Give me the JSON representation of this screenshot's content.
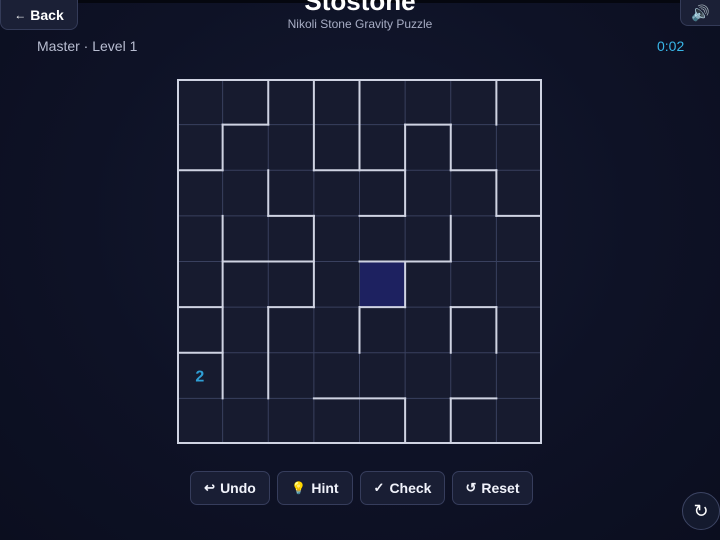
{
  "header": {
    "back_label": "Back",
    "back_icon": "←",
    "title": "Stostone",
    "subtitle": "Nikoli Stone Gravity Puzzle",
    "sound_icon": "🔊"
  },
  "status": {
    "level": "Master · Level 1",
    "timer": "0:02"
  },
  "board": {
    "size": 8,
    "clues": [
      {
        "row": 6,
        "col": 0,
        "value": "2"
      }
    ],
    "highlighted_cells": [
      {
        "row": 4,
        "col": 4
      }
    ],
    "colors": {
      "grid_line": "#39405e",
      "region_border": "#cfd3e2",
      "cell": "#171b2f",
      "highlight": "#1d2160",
      "clue": "#2f9fd6"
    }
  },
  "controls": {
    "undo_label": "Undo",
    "undo_icon": "↩",
    "hint_label": "Hint",
    "hint_icon": "💡",
    "check_label": "Check",
    "check_icon": "✓",
    "reset_label": "Reset",
    "reset_icon": "↺",
    "refresh_icon": "↻"
  }
}
